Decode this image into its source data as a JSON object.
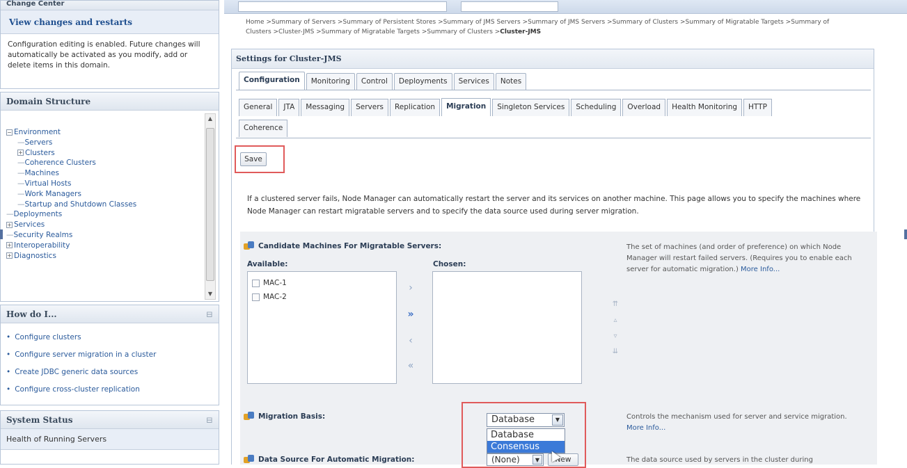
{
  "change_center": {
    "title": "Change Center",
    "view_changes": "View changes and restarts",
    "note": "Configuration editing is enabled. Future changes will automatically be activated as you modify, add or delete items in this domain."
  },
  "domain_structure": {
    "title": "Domain Structure",
    "tree": [
      {
        "label": "Environment",
        "level": 0,
        "toggle": "minus"
      },
      {
        "label": "Servers",
        "level": 1,
        "toggle": "none"
      },
      {
        "label": "Clusters",
        "level": 1,
        "toggle": "plus"
      },
      {
        "label": "Coherence Clusters",
        "level": 1,
        "toggle": "none"
      },
      {
        "label": "Machines",
        "level": 1,
        "toggle": "none"
      },
      {
        "label": "Virtual Hosts",
        "level": 1,
        "toggle": "none"
      },
      {
        "label": "Work Managers",
        "level": 1,
        "toggle": "none"
      },
      {
        "label": "Startup and Shutdown Classes",
        "level": 1,
        "toggle": "none"
      },
      {
        "label": "Deployments",
        "level": 0,
        "toggle": "none"
      },
      {
        "label": "Services",
        "level": 0,
        "toggle": "plus"
      },
      {
        "label": "Security Realms",
        "level": 0,
        "toggle": "none"
      },
      {
        "label": "Interoperability",
        "level": 0,
        "toggle": "plus"
      },
      {
        "label": "Diagnostics",
        "level": 0,
        "toggle": "plus"
      }
    ]
  },
  "how_do_i": {
    "title": "How do I...",
    "items": [
      "Configure clusters",
      "Configure server migration in a cluster",
      "Create JDBC generic data sources",
      "Configure cross-cluster replication"
    ]
  },
  "system_status": {
    "title": "System Status",
    "health_label": "Health of Running Servers"
  },
  "breadcrumb": {
    "line1": "Home >Summary of Servers >Summary of Persistent Stores >Summary of JMS Servers >Summary of JMS Servers >Summary of Clusters >Summary of Migratable Targets >Summary of",
    "line2_prefix": "Clusters >Cluster-JMS >Summary of Migratable Targets >Summary of Clusters >",
    "line2_current": "Cluster-JMS"
  },
  "settings": {
    "title": "Settings for Cluster-JMS",
    "tabs": [
      "Configuration",
      "Monitoring",
      "Control",
      "Deployments",
      "Services",
      "Notes"
    ],
    "active_tab": "Configuration",
    "subtabs_row1": [
      "General",
      "JTA",
      "Messaging",
      "Servers",
      "Replication",
      "Migration",
      "Singleton Services",
      "Scheduling",
      "Overload",
      "Health Monitoring",
      "HTTP"
    ],
    "subtabs_row2": [
      "Coherence"
    ],
    "active_subtab": "Migration",
    "save_label": "Save",
    "description": "If a clustered server fails, Node Manager can automatically restart the server and its services on another machine. This page allows you to specify the machines where Node Manager can restart migratable servers and to specify the data source used during server migration."
  },
  "candidate_machines": {
    "label": "Candidate Machines For Migratable Servers:",
    "available_label": "Available:",
    "chosen_label": "Chosen:",
    "available": [
      "MAC-1",
      "MAC-2"
    ],
    "chosen": [],
    "help": "The set of machines (and order of preference) on which Node Manager will restart failed servers. (Requires you to enable each server for automatic migration.)",
    "more_info": "More Info..."
  },
  "migration_basis": {
    "label": "Migration Basis:",
    "selected": "Database",
    "options": [
      "Database",
      "Consensus"
    ],
    "highlighted_option": "Consensus",
    "help": "Controls the mechanism used for server and service migration.",
    "more_info": "More Info..."
  },
  "data_source": {
    "label": "Data Source For Automatic Migration:",
    "selected": "(None)",
    "new_label": "New",
    "help": "The data source used by servers in the cluster during"
  },
  "colors": {
    "accent": "#2a5a9b",
    "highlight_box": "#e05a5a",
    "selected_option": "#3b7ad8"
  }
}
